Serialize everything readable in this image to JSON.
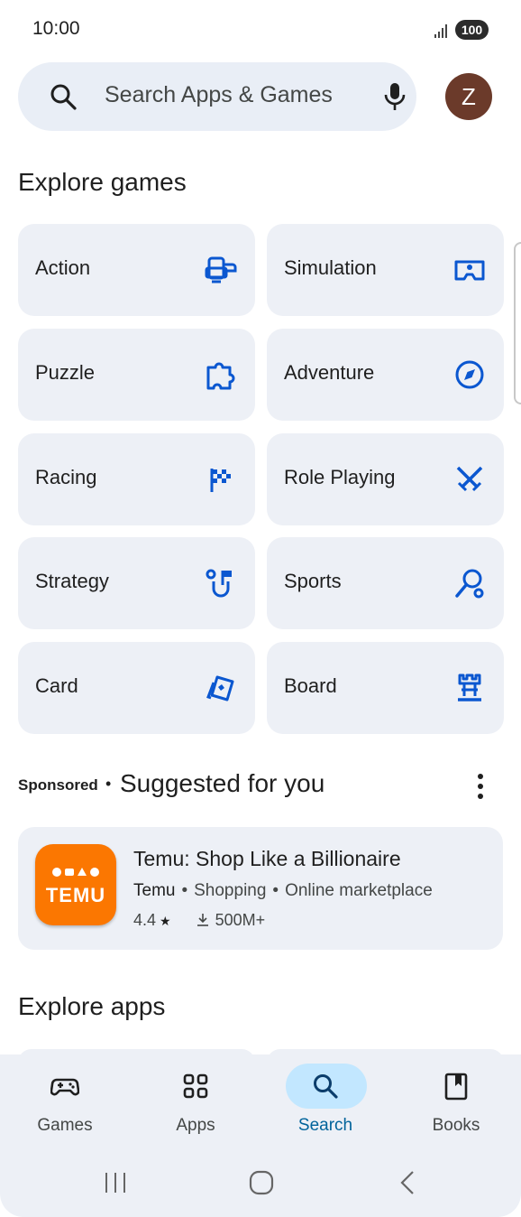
{
  "status": {
    "time": "10:00",
    "battery": "100"
  },
  "search": {
    "placeholder": "Search Apps & Games",
    "avatar_letter": "Z"
  },
  "explore_games": {
    "title": "Explore games",
    "categories": [
      {
        "label": "Action",
        "icon": "gamepad-console-icon"
      },
      {
        "label": "Simulation",
        "icon": "vr-headset-icon"
      },
      {
        "label": "Puzzle",
        "icon": "puzzle-piece-icon"
      },
      {
        "label": "Adventure",
        "icon": "compass-icon"
      },
      {
        "label": "Racing",
        "icon": "checkered-flag-icon"
      },
      {
        "label": "Role Playing",
        "icon": "crossed-swords-icon"
      },
      {
        "label": "Strategy",
        "icon": "strategy-flag-icon"
      },
      {
        "label": "Sports",
        "icon": "ping-pong-icon"
      },
      {
        "label": "Card",
        "icon": "playing-card-icon"
      },
      {
        "label": "Board",
        "icon": "chess-rook-icon"
      }
    ]
  },
  "suggested": {
    "sponsored_label": "Sponsored",
    "separator": "•",
    "title": "Suggested for you",
    "app": {
      "name": "Temu: Shop Like a Billionaire",
      "developer": "Temu",
      "category": "Shopping",
      "tag": "Online marketplace",
      "rating": "4.4",
      "downloads": "500M+",
      "logo_text": "TEMU",
      "logo_color": "#fb7701"
    }
  },
  "explore_apps": {
    "title": "Explore apps"
  },
  "bottom_nav": {
    "items": [
      {
        "label": "Games",
        "icon": "gamepad-icon",
        "active": false
      },
      {
        "label": "Apps",
        "icon": "apps-grid-icon",
        "active": false
      },
      {
        "label": "Search",
        "icon": "search-icon",
        "active": true
      },
      {
        "label": "Books",
        "icon": "book-icon",
        "active": false
      }
    ]
  },
  "colors": {
    "accent": "#0b57d0",
    "tile_bg": "#edf0f6",
    "active_pill": "#c2e7ff"
  }
}
